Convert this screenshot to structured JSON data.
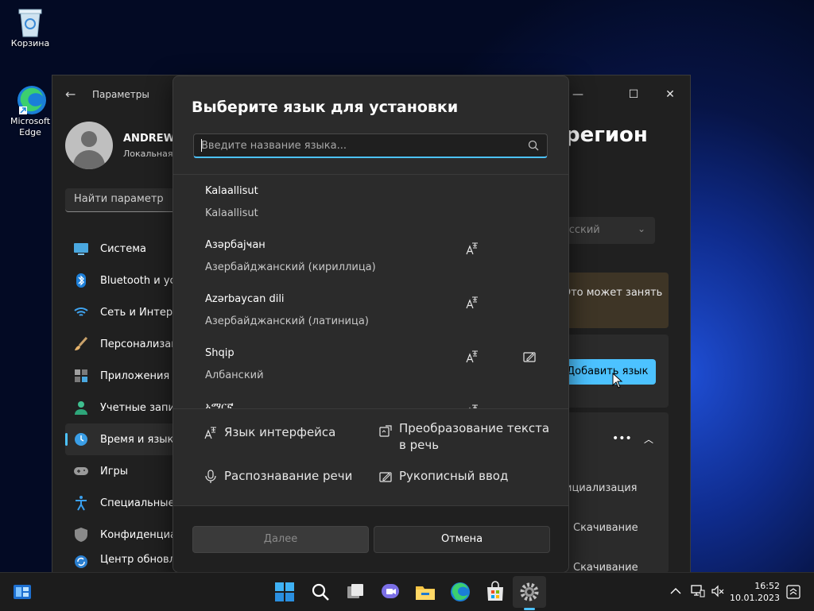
{
  "desktop": {
    "icons": [
      {
        "label": "Корзина"
      },
      {
        "label": "Microsoft Edge"
      }
    ]
  },
  "settings": {
    "title": "Параметры",
    "user": {
      "name": "ANDREW",
      "role": "Локальная"
    },
    "search_placeholder": "Найти параметр",
    "nav": [
      {
        "label": "Система",
        "icon": "monitor-icon"
      },
      {
        "label": "Bluetooth и устр",
        "icon": "bluetooth-icon"
      },
      {
        "label": "Сеть и Интерн",
        "icon": "wifi-icon"
      },
      {
        "label": "Персонализац",
        "icon": "brush-icon"
      },
      {
        "label": "Приложения",
        "icon": "apps-icon"
      },
      {
        "label": "Учетные запис",
        "icon": "person-icon"
      },
      {
        "label": "Время и язык",
        "icon": "clock-globe-icon",
        "active": true
      },
      {
        "label": "Игры",
        "icon": "gamepad-icon"
      },
      {
        "label": "Специальные",
        "icon": "accessibility-icon"
      },
      {
        "label": "Конфиденциал",
        "icon": "shield-icon"
      },
      {
        "label": "Центр обновл",
        "icon": "update-icon"
      }
    ],
    "right": {
      "title": "регион",
      "dropdown_value": "усский",
      "warning_text": "Это может занять",
      "add_language": "Добавить язык",
      "rows": [
        "ициализация",
        "Скачивание",
        "Скачивание"
      ]
    }
  },
  "dialog": {
    "title": "Выберите язык для установки",
    "search_placeholder": "Введите название языка...",
    "languages": [
      {
        "name": "Kalaallisut",
        "native": "Kalaallisut",
        "features": []
      },
      {
        "name": "Азәрбајҹан",
        "native": "Азербайджанский (кириллица)",
        "features": [
          "display-language"
        ]
      },
      {
        "name": "Azərbaycan dili",
        "native": "Азербайджанский (латиница)",
        "features": [
          "display-language"
        ]
      },
      {
        "name": "Shqip",
        "native": "Албанский",
        "features": [
          "display-language",
          "handwriting"
        ]
      },
      {
        "name": "አማርኛ",
        "native": "",
        "features": [
          "display-language"
        ]
      }
    ],
    "features": {
      "display_language": "Язык интерфейса",
      "text_to_speech": "Преобразование текста в речь",
      "speech_recognition": "Распознавание речи",
      "handwriting": "Рукописный ввод"
    },
    "buttons": {
      "next": "Далее",
      "cancel": "Отмена"
    }
  },
  "taskbar": {
    "time": "16:52",
    "date": "10.01.2023"
  },
  "colors": {
    "accent": "#4cc2ff",
    "dialog_bg": "#2b2b2b",
    "window_bg": "#202020"
  }
}
